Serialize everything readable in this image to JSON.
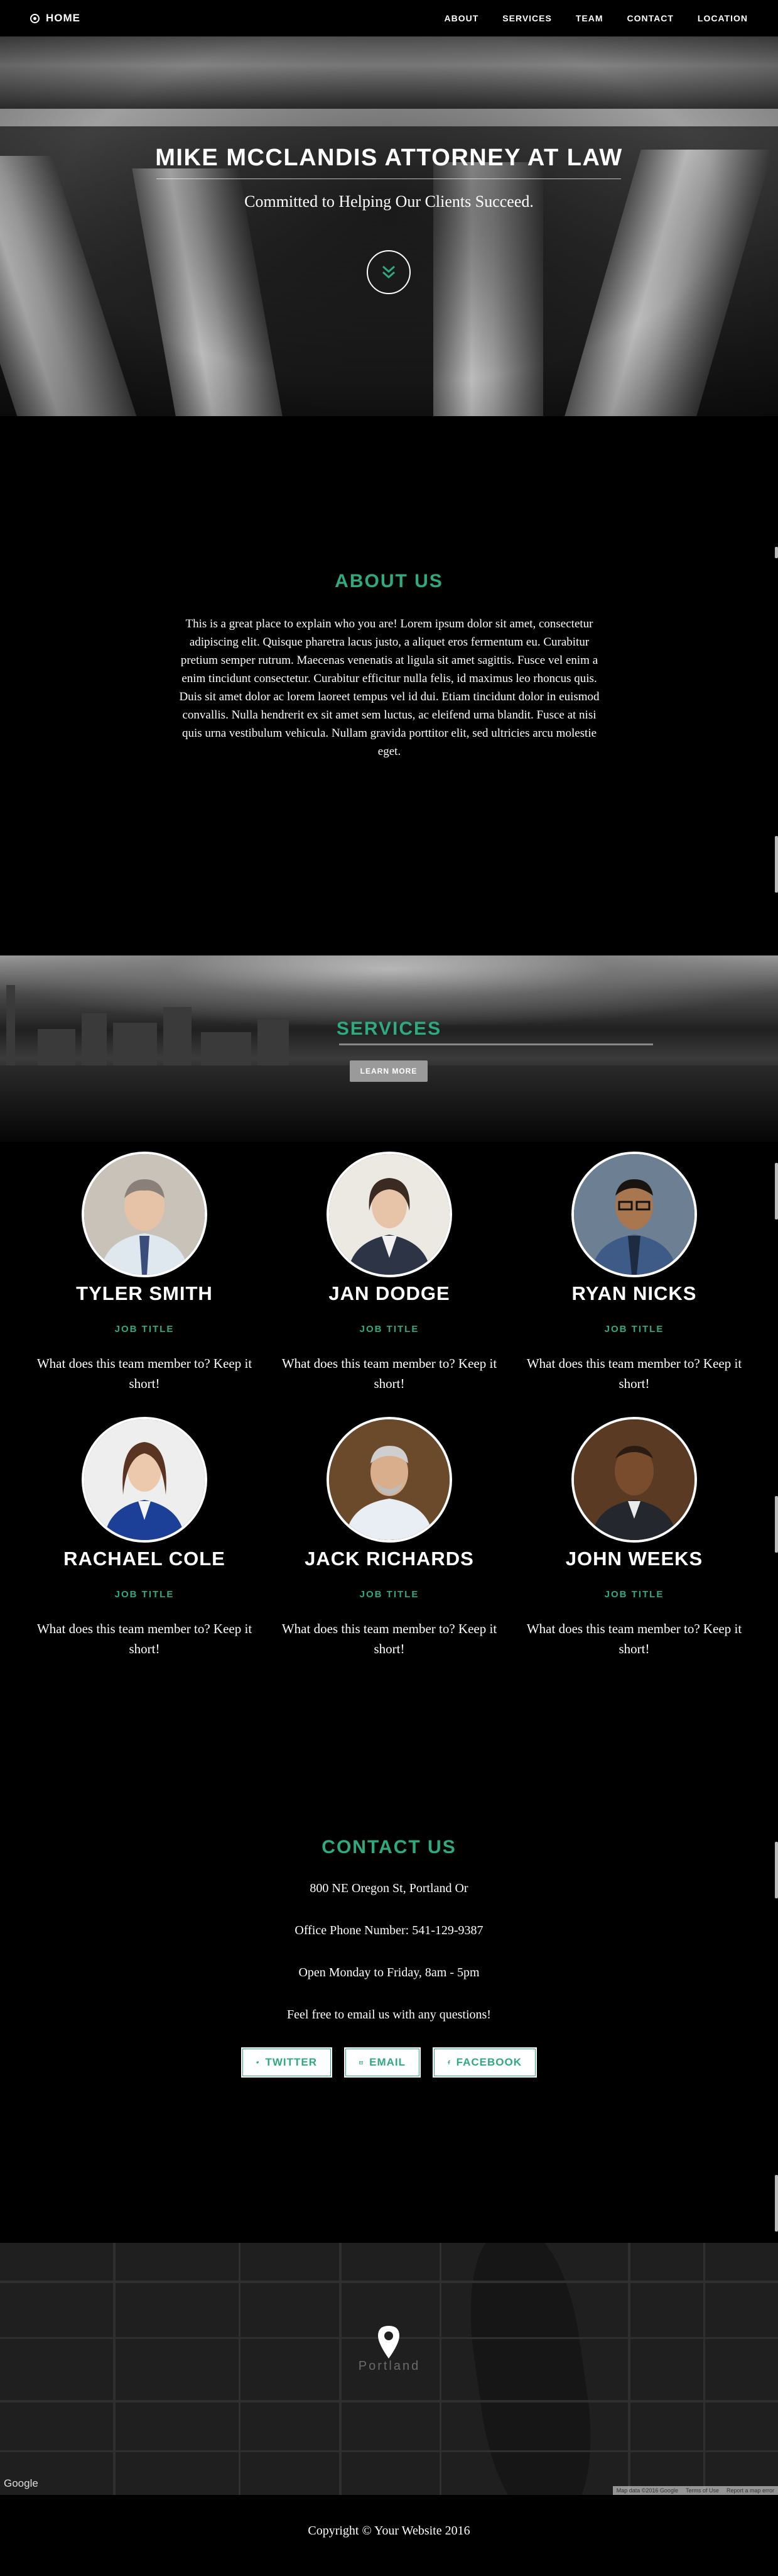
{
  "nav": {
    "brand": "HOME",
    "links": [
      "ABOUT",
      "SERVICES",
      "TEAM",
      "CONTACT",
      "LOCATION"
    ]
  },
  "hero": {
    "title": "MIKE MCCLANDIS ATTORNEY AT LAW",
    "subtitle": "Committed to Helping Our Clients Succeed."
  },
  "about": {
    "title": "ABOUT US",
    "text": "This is a great place to explain who you are! Lorem ipsum dolor sit amet, consectetur adipiscing elit. Quisque pharetra lacus justo, a aliquet eros fermentum eu. Curabitur pretium semper rutrum. Maecenas venenatis at ligula sit amet sagittis. Fusce vel enim a enim tincidunt consectetur. Curabitur efficitur nulla felis, id maximus leo rhoncus quis. Duis sit amet dolor ac lorem laoreet tempus vel id dui. Etiam tincidunt dolor in euismod convallis. Nulla hendrerit ex sit amet sem luctus, ac eleifend urna blandit. Fusce at nisi quis urna vestibulum vehicula. Nullam gravida porttitor elit, sed ultricies arcu molestie eget."
  },
  "services": {
    "title": "SERVICES",
    "button": "LEARN MORE"
  },
  "team": [
    {
      "name": "TYLER SMITH",
      "title": "JOB TITLE",
      "desc": "What does this team member to? Keep it short!"
    },
    {
      "name": "JAN DODGE",
      "title": "JOB TITLE",
      "desc": "What does this team member to? Keep it short!"
    },
    {
      "name": "RYAN NICKS",
      "title": "JOB TITLE",
      "desc": "What does this team member to? Keep it short!"
    },
    {
      "name": "RACHAEL COLE",
      "title": "JOB TITLE",
      "desc": "What does this team member to? Keep it short!"
    },
    {
      "name": "JACK RICHARDS",
      "title": "JOB TITLE",
      "desc": "What does this team member to? Keep it short!"
    },
    {
      "name": "JOHN WEEKS",
      "title": "JOB TITLE",
      "desc": "What does this team member to? Keep it short!"
    }
  ],
  "contact": {
    "title": "CONTACT US",
    "address": "800 NE Oregon St, Portland Or",
    "phone": "Office Phone Number: 541-129-9387",
    "hours": "Open Monday to Friday, 8am - 5pm",
    "email_note": "Feel free to email us with any questions!",
    "buttons": [
      "TWITTER",
      "EMAIL",
      "FACEBOOK"
    ]
  },
  "map": {
    "city_label": "Portland",
    "provider": "Google",
    "credits": [
      "Map data ©2016 Google",
      "Terms of Use",
      "Report a map error"
    ]
  },
  "footer": {
    "copyright": "Copyright © Your Website 2016"
  },
  "colors": {
    "accent": "#2faa7e",
    "background": "#000000"
  }
}
